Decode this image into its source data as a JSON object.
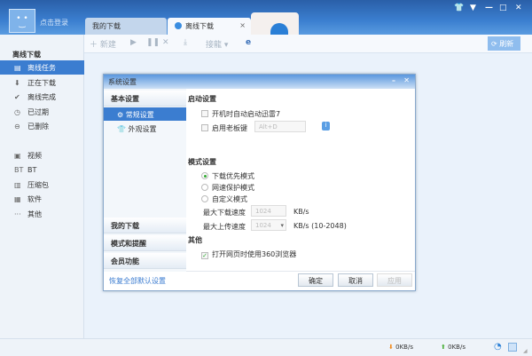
{
  "header": {
    "login": "点击登录",
    "tabs": [
      {
        "label": "我的下载"
      },
      {
        "label": "离线下载",
        "close": "×"
      }
    ],
    "window_controls": [
      "skin-icon",
      "menu-icon",
      "minimize-icon",
      "maximize-icon",
      "close-icon"
    ]
  },
  "toolbar": {
    "new": "新建",
    "download": "接龍",
    "refresh": "刷新"
  },
  "sidebar": {
    "heading": "离线下载",
    "items": [
      {
        "label": "离线任务",
        "icon": "document-icon"
      },
      {
        "label": "正在下载",
        "icon": "download-icon"
      },
      {
        "label": "离线完成",
        "icon": "check-icon"
      },
      {
        "label": "已过期",
        "icon": "clock-icon"
      },
      {
        "label": "已删除",
        "icon": "delete-icon"
      }
    ],
    "categories": [
      {
        "label": "视频",
        "icon": "▣"
      },
      {
        "label": "BT",
        "icon": "BT"
      },
      {
        "label": "压缩包",
        "icon": "▥"
      },
      {
        "label": "软件",
        "icon": "▦"
      },
      {
        "label": "其他",
        "icon": "···"
      }
    ]
  },
  "dialog": {
    "title": "系统设置",
    "nav": {
      "basic": "基本设置",
      "items": [
        "常规设置",
        "外观设置"
      ],
      "sections": [
        "我的下载",
        "模式和提醒",
        "会员功能"
      ]
    },
    "startup": {
      "title": "启动设置",
      "autostart": "开机时自动启动迅雷7",
      "bosskey": "启用老板键",
      "bosskey_value": "Alt+D"
    },
    "mode": {
      "title": "模式设置",
      "options": [
        "下载优先模式",
        "网速保护模式",
        "自定义模式"
      ],
      "selected": 0,
      "max_down_label": "最大下载速度",
      "max_down": "1024",
      "max_up_label": "最大上传速度",
      "max_up": "1024",
      "unit": "KB/s",
      "range": "KB/s  (10-2048)"
    },
    "other": {
      "title": "其他",
      "browser": "打开网页时使用360浏览器",
      "browser_checked": true
    },
    "reset": "恢复全部默认设置",
    "ok": "确定",
    "cancel": "取消",
    "apply": "应用"
  },
  "status": {
    "down": "0KB/s",
    "up": "0KB/s"
  }
}
